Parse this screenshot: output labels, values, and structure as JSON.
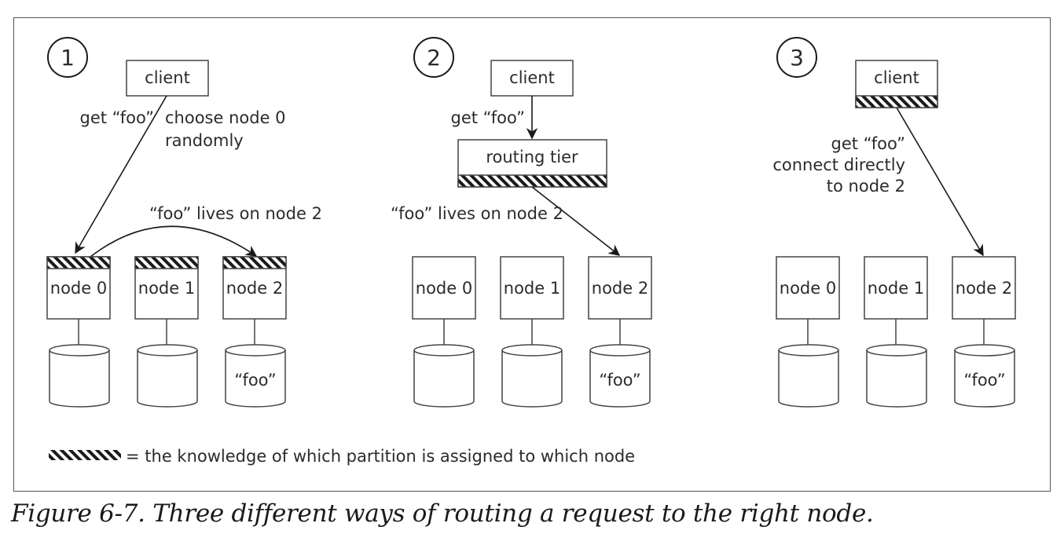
{
  "legend": {
    "symbol": "hatched-bar",
    "text": "= the knowledge of which partition is assigned to which node"
  },
  "caption": "Figure 6-7. Three different ways of routing a request to the right node.",
  "panels": [
    {
      "number": "1",
      "client_label": "client",
      "client_has_knowledge": false,
      "request_label": "get “foo”",
      "note_lines": [
        "choose node 0",
        "randomly"
      ],
      "forward_label": "“foo” lives on node 2",
      "nodes": [
        {
          "label": "node 0",
          "has_knowledge": true,
          "store": ""
        },
        {
          "label": "node 1",
          "has_knowledge": true,
          "store": ""
        },
        {
          "label": "node 2",
          "has_knowledge": true,
          "store": "“foo”"
        }
      ]
    },
    {
      "number": "2",
      "client_label": "client",
      "client_has_knowledge": false,
      "request_label": "get “foo”",
      "routing_tier_label": "routing tier",
      "routing_tier_has_knowledge": true,
      "forward_label": "“foo” lives on node 2",
      "nodes": [
        {
          "label": "node 0",
          "has_knowledge": false,
          "store": ""
        },
        {
          "label": "node 1",
          "has_knowledge": false,
          "store": ""
        },
        {
          "label": "node 2",
          "has_knowledge": false,
          "store": "“foo”"
        }
      ]
    },
    {
      "number": "3",
      "client_label": "client",
      "client_has_knowledge": true,
      "request_lines": [
        "get “foo”",
        "connect directly",
        "to node 2"
      ],
      "nodes": [
        {
          "label": "node 0",
          "has_knowledge": false,
          "store": ""
        },
        {
          "label": "node 1",
          "has_knowledge": false,
          "store": ""
        },
        {
          "label": "node 2",
          "has_knowledge": false,
          "store": "“foo”"
        }
      ]
    }
  ]
}
